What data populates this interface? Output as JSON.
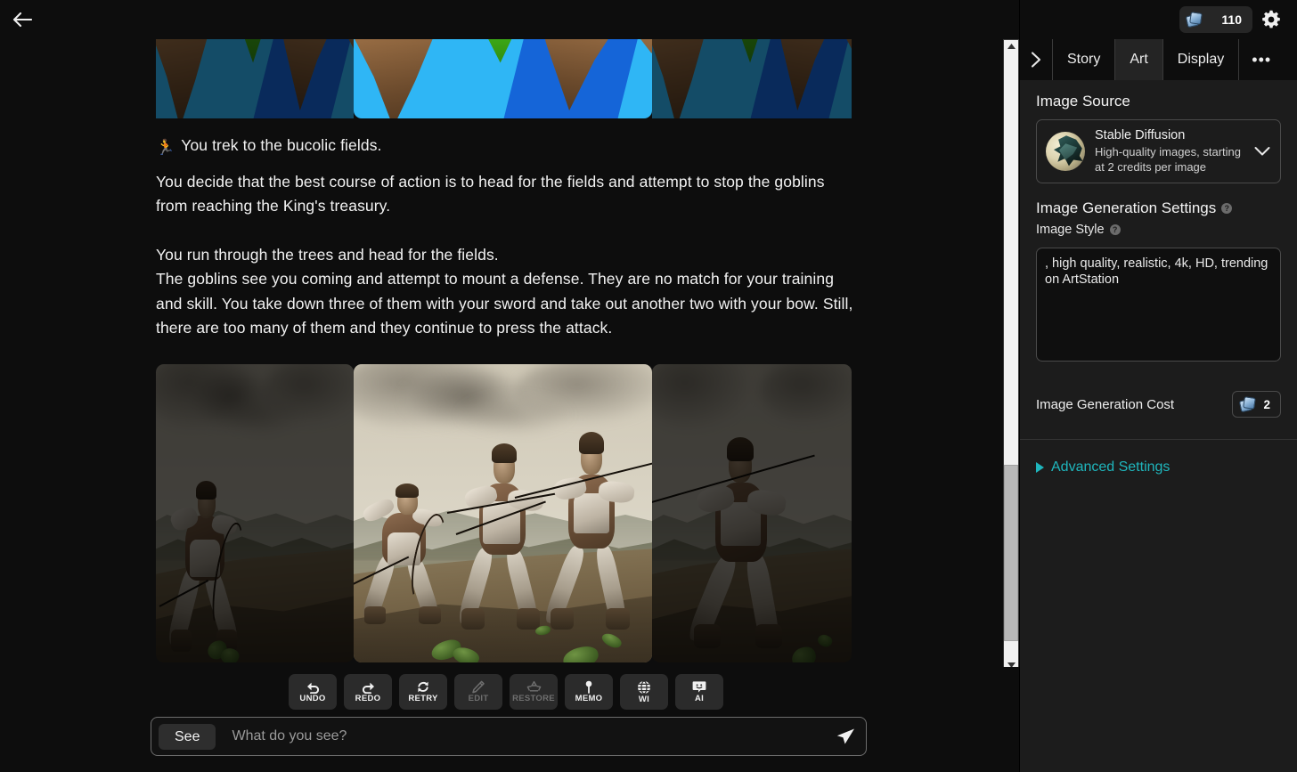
{
  "header": {
    "back_icon": "arrow-left-icon",
    "credits": "110",
    "credits_icon": "credit-token-icon",
    "settings_icon": "gear-icon"
  },
  "tabs": {
    "expand_icon": "chevron-right-icon",
    "items": [
      {
        "label": "Story",
        "active": false
      },
      {
        "label": "Art",
        "active": true
      },
      {
        "label": "Display",
        "active": false
      }
    ],
    "more_label": "•••"
  },
  "story": {
    "action_icon": "running-person-icon",
    "action_line": "You trek to the bucolic fields.",
    "paragraphs": [
      "You decide that the best course of action is to head for the fields and attempt to stop the goblins from reaching the King's treasury.",
      "You run through the trees and head for the fields.",
      "The goblins see you coming and attempt to mount a defense. They are no match for your training and skill. You take down three of them with your sword and take out another two with your bow. Still, there are too many of them and they continue to press the attack."
    ]
  },
  "actions": [
    {
      "label": "UNDO",
      "icon": "undo-arrow-icon",
      "disabled": false
    },
    {
      "label": "REDO",
      "icon": "redo-arrow-icon",
      "disabled": false
    },
    {
      "label": "RETRY",
      "icon": "refresh-icon",
      "disabled": false
    },
    {
      "label": "EDIT",
      "icon": "pencil-icon",
      "disabled": true
    },
    {
      "label": "RESTORE",
      "icon": "recycle-icon",
      "disabled": true
    },
    {
      "label": "MEMO",
      "icon": "pin-icon",
      "disabled": false
    },
    {
      "label": "WI",
      "icon": "globe-icon",
      "disabled": false
    },
    {
      "label": "AI",
      "icon": "speech-bubble-icon",
      "disabled": false
    }
  ],
  "prompt": {
    "mode_label": "See",
    "placeholder": "What do you see?",
    "value": "",
    "send_icon": "send-paper-plane-icon"
  },
  "sidebar": {
    "image_source": {
      "title": "Image Source",
      "avatar_icon": "dragon-avatar",
      "name": "Stable Diffusion",
      "description": "High-quality images, starting at 2 credits per image",
      "chevron_icon": "chevron-down-icon"
    },
    "generation_settings": {
      "title": "Image Generation Settings",
      "help_icon": "help-circle-icon",
      "style_label": "Image Style",
      "style_help_icon": "help-circle-icon",
      "style_value": ", high quality, realistic, 4k, HD, trending on ArtStation",
      "style_placeholder": "",
      "cost_label": "Image Generation Cost",
      "cost_value": "2",
      "cost_icon": "credit-token-icon"
    },
    "advanced": {
      "label": "Advanced Settings",
      "caret_icon": "triangle-right-icon"
    }
  },
  "scrollbar": {
    "up_icon": "scroll-up-arrow-icon",
    "down_icon": "scroll-down-arrow-icon"
  },
  "colors": {
    "accent_teal": "#1fb6bd",
    "background": "#0d0d0d",
    "sidebar_bg": "#1c1c1c",
    "text": "#f2f2f2"
  }
}
